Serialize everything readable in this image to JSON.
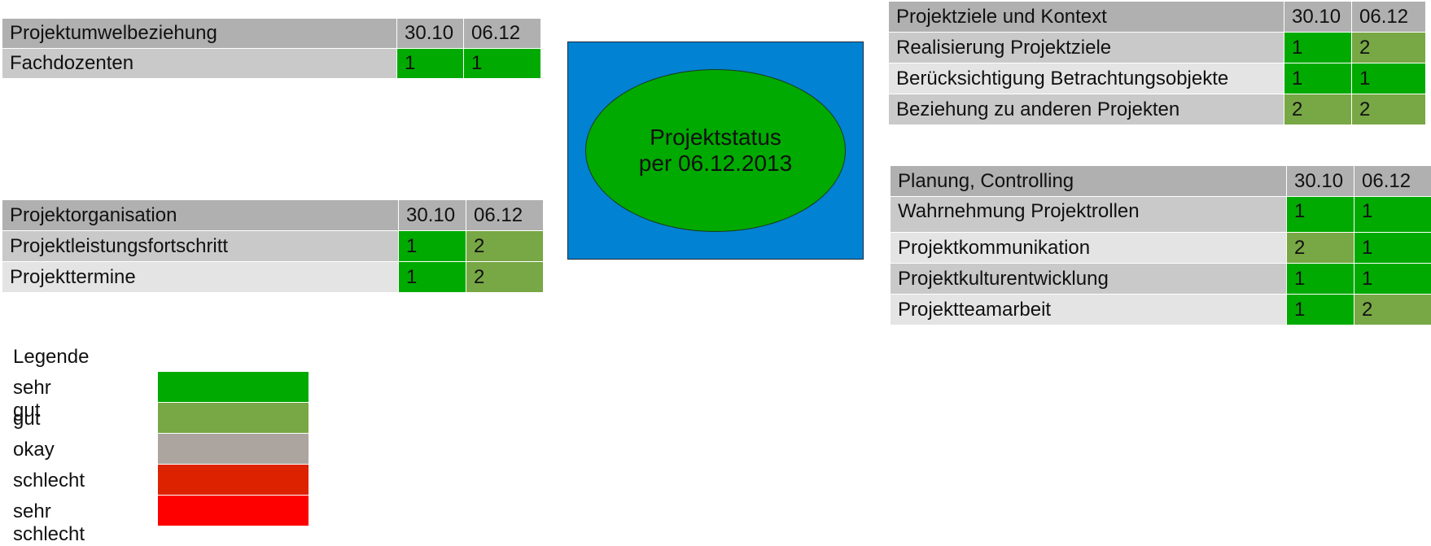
{
  "colors": {
    "sehr_gut": "#00aa00",
    "gut": "#78a745",
    "okay": "#aba49f",
    "schlecht": "#dd2200",
    "sehr_schlecht": "#ff0000",
    "status_box": "#0182d2",
    "header_gray": "#b0b0b0"
  },
  "tables": {
    "umwelt": {
      "header": [
        "Projektumwelbeziehung",
        "30.10",
        "06.12"
      ],
      "rows": [
        {
          "label": "Fachdozenten",
          "v1": "1",
          "v2": "1"
        }
      ]
    },
    "org": {
      "header": [
        "Projektorganisation",
        "30.10",
        "06.12"
      ],
      "rows": [
        {
          "label": "Projektleistungsfortschritt",
          "v1": "1",
          "v2": "2"
        },
        {
          "label": "Projekttermine",
          "v1": "1",
          "v2": "2"
        }
      ]
    },
    "ziele": {
      "header": [
        "Projektziele und Kontext",
        "30.10",
        "06.12"
      ],
      "rows": [
        {
          "label": "Realisierung Projektziele",
          "v1": "1",
          "v2": "2"
        },
        {
          "label": "Berücksichtigung Betrachtungsobjekte",
          "v1": "1",
          "v2": "1"
        },
        {
          "label": "Beziehung zu anderen Projekten",
          "v1": "2",
          "v2": "2"
        }
      ]
    },
    "plan": {
      "header": [
        "Planung, Controlling",
        "30.10",
        "06.12"
      ],
      "rows": [
        {
          "label": "Wahrnehmung Projektrollen",
          "v1": "1",
          "v2": "1"
        },
        {
          "label": "Projektkommunikation",
          "v1": "2",
          "v2": "1"
        },
        {
          "label": "Projektkulturentwicklung",
          "v1": "1",
          "v2": "1"
        },
        {
          "label": "Projektteamarbeit",
          "v1": "1",
          "v2": "2"
        }
      ]
    }
  },
  "status": {
    "line1": "Projektstatus",
    "line2": "per 06.12.2013"
  },
  "legend": {
    "title": "Legende",
    "items": [
      {
        "label": "sehr gut",
        "color": "#00aa00"
      },
      {
        "label": "gut",
        "color": "#78a745"
      },
      {
        "label": "okay",
        "color": "#aba49f"
      },
      {
        "label": "schlecht",
        "color": "#dd2200"
      },
      {
        "label": "sehr schlecht",
        "color": "#ff0000"
      }
    ]
  }
}
